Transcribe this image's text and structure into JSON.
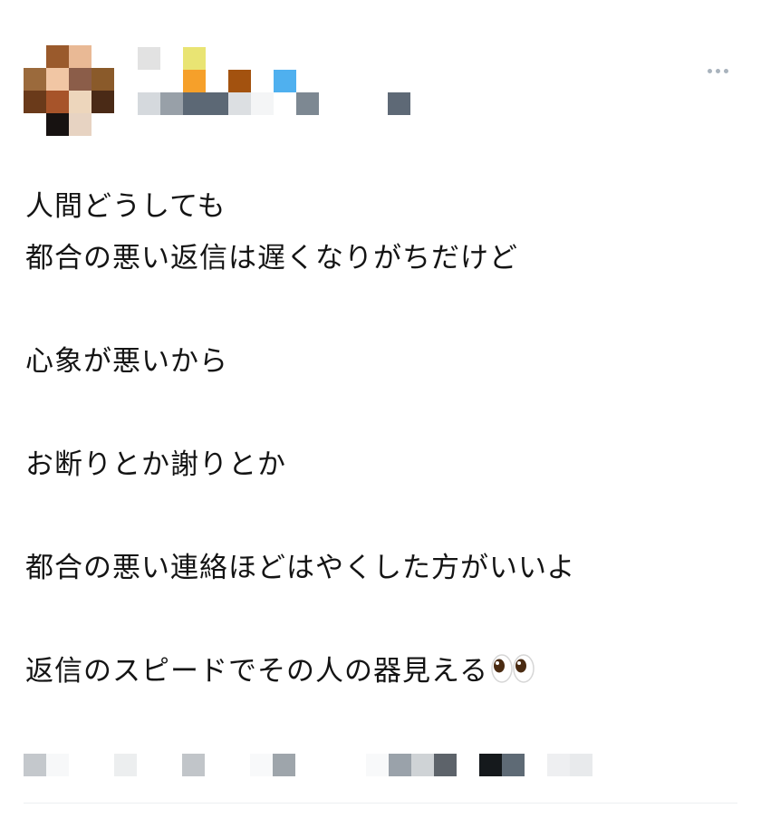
{
  "post": {
    "menu_icon": "more-horizontal-icon",
    "lines": [
      "人間どうしても",
      "都合の悪い返信は遅くなりがちだけど",
      "",
      "心象が悪いから",
      "",
      "お断りとか謝りとか",
      "",
      "都合の悪い連絡ほどはやくした方がいいよ",
      "",
      "返信のスピードでその人の器見える"
    ],
    "trailing_emoji": "eyes-emoji"
  },
  "colors": {
    "text": "#141414",
    "menu_dots": "#a9b3bd",
    "divider": "#eceff1"
  }
}
